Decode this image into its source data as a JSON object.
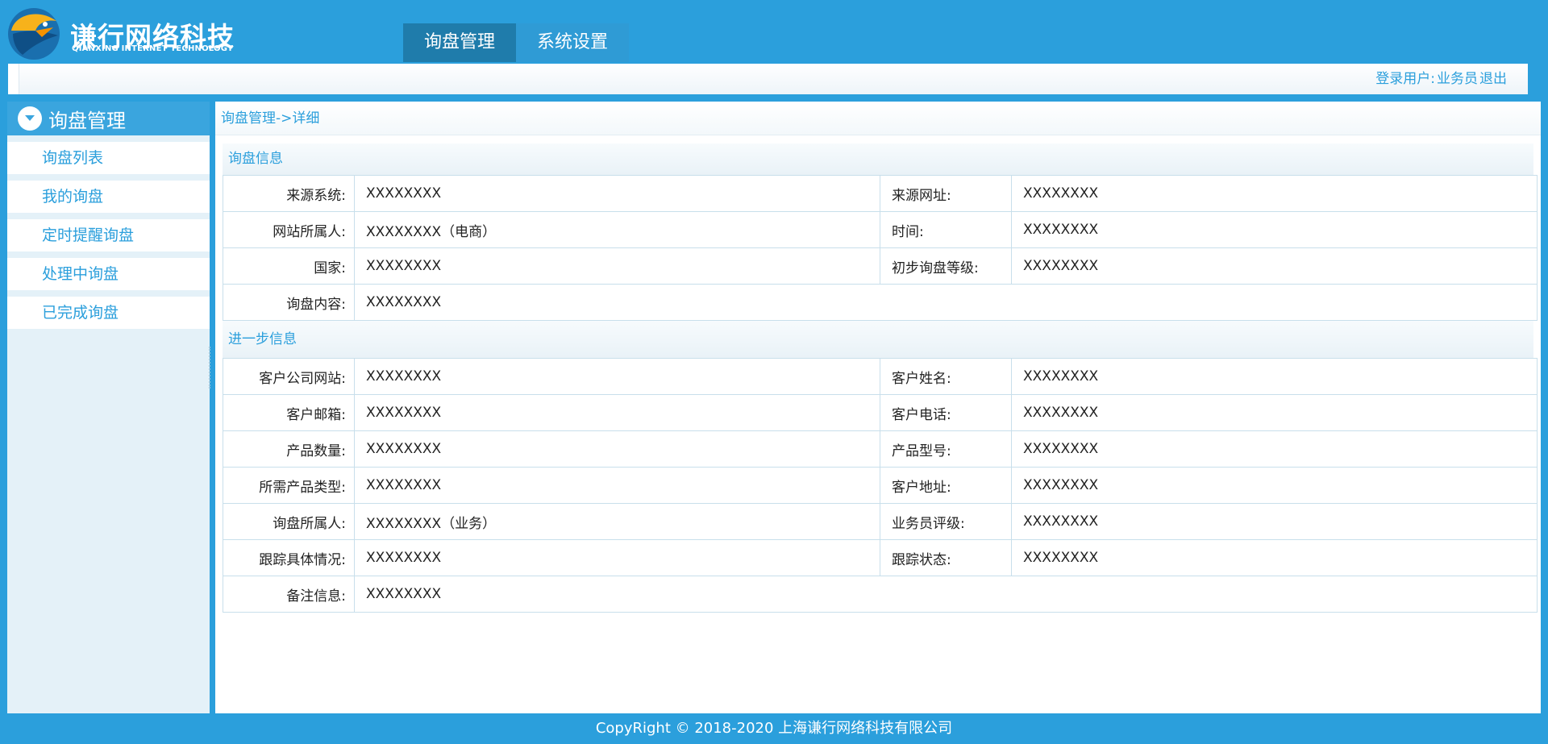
{
  "header": {
    "logo_title": "谦行网络科技",
    "logo_subtitle": "QIANXING INTERNET TECHNOLOGY",
    "nav_tabs": [
      {
        "label": "询盘管理",
        "active": true
      },
      {
        "label": "系统设置",
        "active": false
      }
    ]
  },
  "userbar": {
    "user_label": "登录用户:",
    "user_name": "业务员",
    "logout_label": "退出"
  },
  "sidebar": {
    "title": "询盘管理",
    "items": [
      {
        "label": "询盘列表"
      },
      {
        "label": "我的询盘"
      },
      {
        "label": "定时提醒询盘"
      },
      {
        "label": "处理中询盘"
      },
      {
        "label": "已完成询盘"
      }
    ]
  },
  "main": {
    "breadcrumb": "询盘管理->详细",
    "section1": {
      "title": "询盘信息",
      "rows": [
        {
          "l1": "来源系统:",
          "v1": "XXXXXXXX",
          "l2": "来源网址:",
          "v2": "XXXXXXXX"
        },
        {
          "l1": "网站所属人:",
          "v1": "XXXXXXXX（电商）",
          "l2": "时间:",
          "v2": "XXXXXXXX"
        },
        {
          "l1": "国家:",
          "v1": "XXXXXXXX",
          "l2": "初步询盘等级:",
          "v2": "XXXXXXXX"
        }
      ],
      "full_row": {
        "label": "询盘内容:",
        "value": "XXXXXXXX"
      }
    },
    "section2": {
      "title": "进一步信息",
      "rows": [
        {
          "l1": "客户公司网站:",
          "v1": "XXXXXXXX",
          "l2": "客户姓名:",
          "v2": "XXXXXXXX"
        },
        {
          "l1": "客户邮箱:",
          "v1": "XXXXXXXX",
          "l2": "客户电话:",
          "v2": "XXXXXXXX"
        },
        {
          "l1": "产品数量:",
          "v1": "XXXXXXXX",
          "l2": "产品型号:",
          "v2": "XXXXXXXX"
        },
        {
          "l1": "所需产品类型:",
          "v1": "XXXXXXXX",
          "l2": "客户地址:",
          "v2": "XXXXXXXX"
        },
        {
          "l1": "询盘所属人:",
          "v1": "XXXXXXXX（业务）",
          "l2": "业务员评级:",
          "v2": "XXXXXXXX"
        },
        {
          "l1": "跟踪具体情况:",
          "v1": "XXXXXXXX",
          "l2": "跟踪状态:",
          "v2": "XXXXXXXX"
        }
      ],
      "full_row": {
        "label": "备注信息:",
        "value": "XXXXXXXX"
      }
    }
  },
  "footer": {
    "copyright": "CopyRight © 2018-2020 上海谦行网络科技有限公司"
  },
  "colors": {
    "brand_blue": "#2b9fdc",
    "active_tab": "#1f7cab",
    "sidebar_bg": "#e4f1f8"
  },
  "icons": {
    "logo": "bird-logo-icon",
    "sidebar_toggle": "chevron-down-circle-icon"
  }
}
